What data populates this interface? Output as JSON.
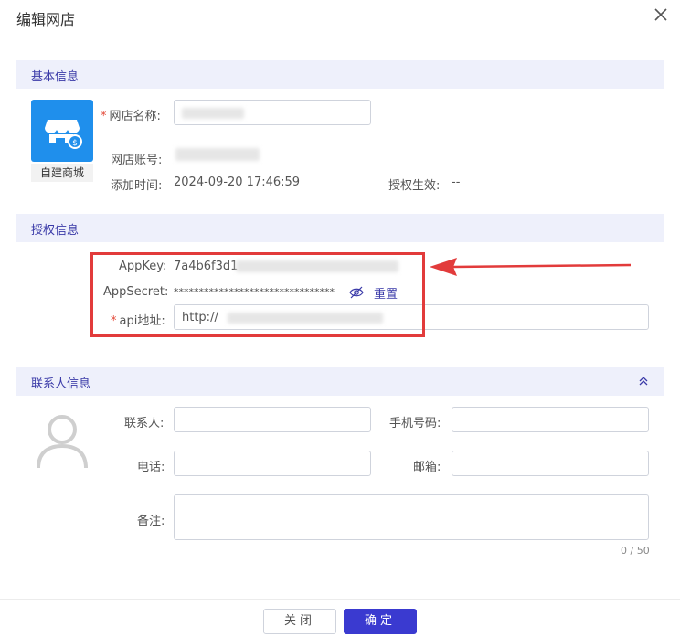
{
  "dialog": {
    "title": "编辑网店"
  },
  "sections": {
    "basic": "基本信息",
    "auth": "授权信息",
    "contact": "联系人信息"
  },
  "basic": {
    "logo_caption": "自建商城",
    "store_name_label": "网店名称:",
    "store_account_label": "网店账号:",
    "added_time_label": "添加时间:",
    "added_time_value": "2024-09-20 17:46:59",
    "auth_effective_label": "授权生效:",
    "auth_effective_value": "--"
  },
  "auth": {
    "appkey_label": "AppKey:",
    "appkey_value": "7a4b6f3d1",
    "appsecret_label": "AppSecret:",
    "appsecret_value": "********************************",
    "reset_label": "重置",
    "api_label": "api地址:",
    "api_value": "http://"
  },
  "contact": {
    "contact_label": "联系人:",
    "mobile_label": "手机号码:",
    "phone_label": "电话:",
    "email_label": "邮箱:",
    "remark_label": "备注:",
    "remark_counter": "0 / 50"
  },
  "footer": {
    "close_label": "关闭",
    "ok_label": "确定"
  },
  "colors": {
    "accent": "#3a3ad0",
    "logo_blue": "#1f8fec",
    "highlight_red": "#e23b3b",
    "required": "#e34a3a"
  }
}
